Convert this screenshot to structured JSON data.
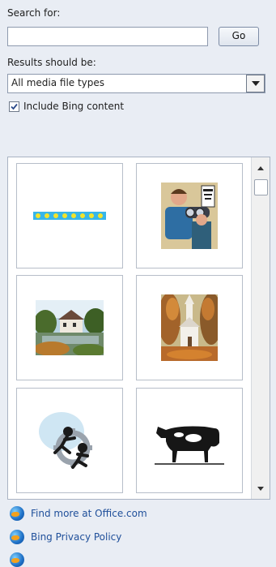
{
  "search": {
    "label": "Search for:",
    "value": "",
    "go_label": "Go"
  },
  "results_type": {
    "label": "Results should be:",
    "selected": "All media file types"
  },
  "include_bing": {
    "label": "Include Bing content",
    "checked": true
  },
  "thumbnails": [
    {
      "name": "decorative-border-clipart"
    },
    {
      "name": "eye-exam-clipart"
    },
    {
      "name": "house-by-lake-clipart"
    },
    {
      "name": "church-in-autumn-clipart"
    },
    {
      "name": "teamwork-gears-clipart"
    },
    {
      "name": "cow-clipart"
    }
  ],
  "links": [
    {
      "label": "Find more at Office.com",
      "icon": "globe-icon"
    },
    {
      "label": "Bing Privacy Policy",
      "icon": "globe-icon"
    },
    {
      "label": "",
      "icon": "globe-icon"
    }
  ]
}
